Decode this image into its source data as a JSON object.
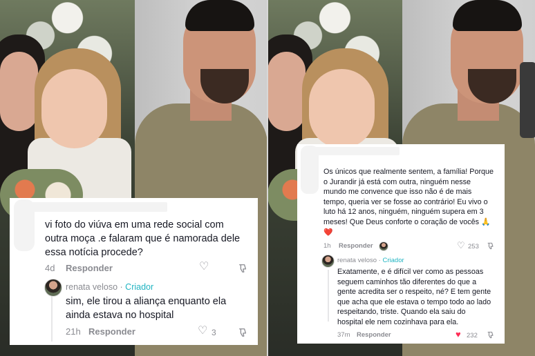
{
  "left_comment": {
    "text": "vi foto do viúva em uma rede social com\noutra moça .e falaram que é namorada dele\nessa notícia procede?",
    "time": "4d",
    "reply_label": "Responder",
    "reply": {
      "author": "renata veloso",
      "sep": " · ",
      "creator_label": "Criador",
      "text": "sim, ele tirou a aliança enquanto ela\nainda estava no hospital",
      "time": "21h",
      "reply_label": "Responder",
      "likes": "3"
    }
  },
  "right_comment": {
    "text": "Os únicos que realmente sentem, a família! Porque\no Jurandir já está com outra, ninguém nesse\nmundo me convence que isso não é de mais\ntempo, queria ver se fosse ao contrário! Eu vivo o\nluto há 12 anos, ninguém, ninguém supera em 3\nmeses! Que Deus conforte o coração de vocês 🙏",
    "emoji_heart": "❤️",
    "time": "1h",
    "reply_label": "Responder",
    "likes": "253",
    "reply": {
      "author": "renata veloso",
      "sep": " · ",
      "creator_label": "Criador",
      "text": "Exatamente, e é difícil ver como as pessoas\nseguem caminhos tão diferentes do que a\ngente acredita ser o respeito, né? E tem gente\nque acha que ele estava o tempo todo ao lado\nrespeitando, triste. Quando ela saiu do\nhospital ele nem cozinhava para ela.",
      "time": "37m",
      "reply_label": "Responder",
      "likes": "232"
    }
  },
  "icons": [
    "heart-icon",
    "dislike-icon",
    "avatar"
  ],
  "colors": {
    "creator": "#20b4c2",
    "liked_heart": "#fe2c55",
    "meta": "#8a8b91"
  }
}
